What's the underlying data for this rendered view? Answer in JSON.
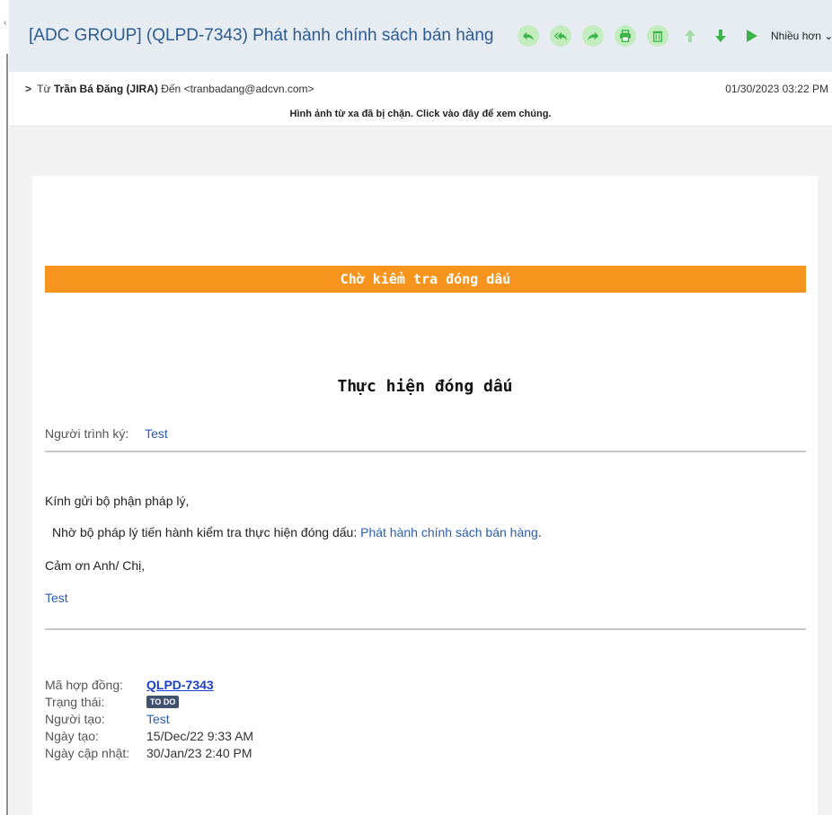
{
  "email": {
    "subject": "[ADC GROUP] (QLPD-7343) Phát hành chính sách bán hàng",
    "from_prefix": "Từ",
    "from_name": "Trần Bá Đăng (JIRA)",
    "to_prefix": "Đến",
    "to_address": "<tranbadang@adcvn.com>",
    "date": "01/30/2023 03:22 PM",
    "blocked_notice": "Hình ảnh từ xa đã bị chặn. Click vào đây để xem chúng."
  },
  "toolbar": {
    "buttons": [
      "reply-icon",
      "reply-all-icon",
      "forward-icon",
      "print-icon",
      "delete-icon",
      "up-arrow-icon",
      "down-arrow-icon",
      "play-icon"
    ],
    "more_label": "Nhiều hơn ⌄"
  },
  "content": {
    "banner": "Chờ kiểm tra đóng dấu",
    "title": "Thực hiện đóng dấu",
    "signer_label": "Người trình ký:",
    "signer_value": "Test",
    "greeting": "Kính gửi bộ phận pháp lý,",
    "request_text": "Nhờ bộ pháp lý tiến hành kiểm tra thực hiện đóng dấu:",
    "request_link": "Phát hành chính sách bán hàng",
    "request_end": ".",
    "thanks": "Cảm ơn Anh/ Chị,",
    "sign_off": "Test"
  },
  "details": {
    "contract_label": "Mã hợp đồng:",
    "contract_value": "QLPD-7343",
    "status_label": "Trạng thái:",
    "status_value": "TO DO",
    "creator_label": "Người tạo:",
    "creator_value": "Test",
    "created_label": "Ngày tạo:",
    "created_value": "15/Dec/22 9:33 AM",
    "updated_label": "Ngày cập nhật:",
    "updated_value": "30/Jan/23 2:40 PM"
  },
  "colors": {
    "banner": "#f7941e",
    "toolbar_icon": "#3bb54a",
    "link": "#2a5db0",
    "subject": "#2d5c91"
  }
}
